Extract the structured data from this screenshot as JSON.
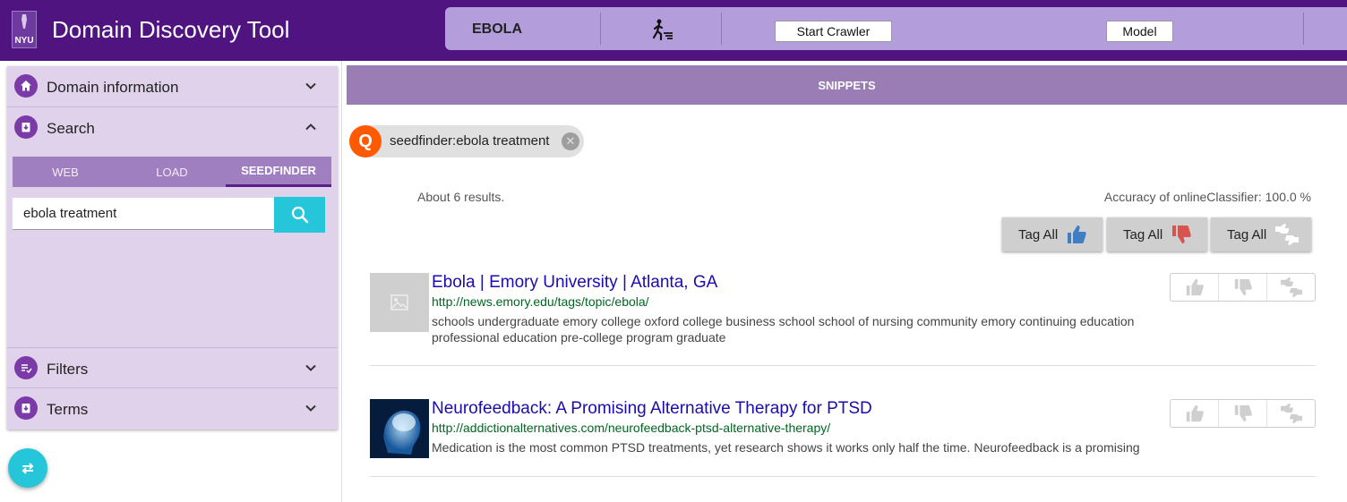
{
  "header": {
    "logo_text": "NYU",
    "app_title": "Domain Discovery Tool",
    "domain": "EBOLA",
    "start_crawler_label": "Start Crawler",
    "model_label": "Model"
  },
  "sidebar": {
    "sections": [
      {
        "label": "Domain information",
        "icon": "home-icon",
        "state": "collapsed"
      },
      {
        "label": "Search",
        "icon": "search-download-icon",
        "state": "expanded"
      },
      {
        "label": "Filters",
        "icon": "filter-list-icon",
        "state": "collapsed"
      },
      {
        "label": "Terms",
        "icon": "terms-download-icon",
        "state": "collapsed"
      }
    ],
    "search_tabs": [
      {
        "label": "WEB",
        "active": false
      },
      {
        "label": "LOAD",
        "active": false
      },
      {
        "label": "SEEDFINDER",
        "active": true
      }
    ],
    "search_value": "ebola treatment"
  },
  "main": {
    "snippets_header": "SNIPPETS",
    "query_chip": {
      "avatar": "Q",
      "label": "seedfinder:ebola treatment"
    },
    "results_count": "About 6 results.",
    "accuracy": "Accuracy of onlineClassifier: 100.0 %",
    "tag_all": [
      {
        "label": "Tag All",
        "icon": "thumbs-up-icon",
        "color": "#3f7fc1"
      },
      {
        "label": "Tag All",
        "icon": "thumbs-down-icon",
        "color": "#d9534f"
      },
      {
        "label": "Tag All",
        "icon": "thumbs-neutral-icon",
        "color": "#ffffff"
      }
    ],
    "results": [
      {
        "title": "Ebola | Emory University | Atlanta, GA",
        "url": "http://news.emory.edu/tags/topic/ebola/",
        "snippet": "schools undergraduate emory college oxford college business school school of nursing community emory continuing education professional education pre-college program graduate",
        "thumbnail": "placeholder-image-icon"
      },
      {
        "title": "Neurofeedback: A Promising Alternative Therapy for PTSD",
        "url": "http://addictionalternatives.com/neurofeedback-ptsd-alternative-therapy/",
        "snippet": "Medication is the most common PTSD treatments, yet research shows it works only half the time. Neurofeedback is a promising",
        "thumbnail": "brain-scan-image"
      }
    ]
  },
  "colors": {
    "header_bg": "#501480",
    "topbar_bg": "#b39ddb",
    "sidebar_bg": "#e1d2ec",
    "accent_cyan": "#26c6da",
    "snippets_bar": "#9b7db5"
  }
}
